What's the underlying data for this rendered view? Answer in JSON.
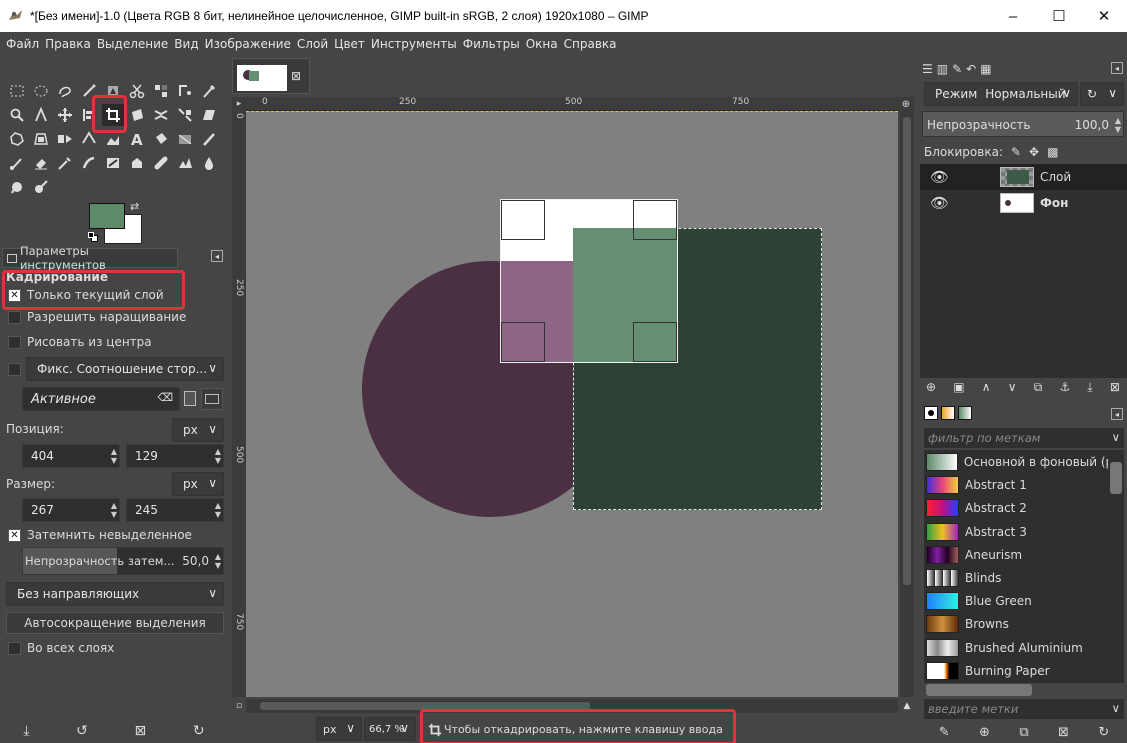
{
  "window": {
    "title": "*[Без имени]-1.0 (Цвета RGB 8 бит, нелинейное целочисленное, GIMP built-in sRGB, 2 слоя) 1920x1080 – GIMP",
    "minimize": "–",
    "maximize": "☐",
    "close": "✕"
  },
  "menu": [
    "Файл",
    "Правка",
    "Выделение",
    "Вид",
    "Изображение",
    "Слой",
    "Цвет",
    "Инструменты",
    "Фильтры",
    "Окна",
    "Справка"
  ],
  "colors": {
    "foreground": "#5e8a6c",
    "background": "#ffffff",
    "highlight": "#e0343a",
    "circle": "#4a3040",
    "dark_square": "#2d4234",
    "green_square": "#658f73",
    "pink_overlap": "#8e6685"
  },
  "tool_options": {
    "tab_label": "Параметры инструментов",
    "tool_name": "Кадрирование",
    "current_layer_only": "Только текущий слой",
    "allow_growing": "Разрешить наращивание",
    "expand_from_center": "Рисовать из центра",
    "fixed_aspect": "Фикс. Соотношение стор...",
    "active_label": "Активное",
    "position_label": "Позиция:",
    "position_unit": "px",
    "position_x": "404",
    "position_y": "129",
    "size_label": "Размер:",
    "size_unit": "px",
    "size_w": "267",
    "size_h": "245",
    "highlight_label": "Затемнить невыделенное",
    "highlight_opacity_label": "Непрозрачность затем...",
    "highlight_opacity_value": "50,0",
    "guides": "Без направляющих",
    "auto_shrink": "Автосокращение выделения",
    "shrink_merged": "Во всех слоях"
  },
  "rulers": {
    "top": [
      "0",
      "250",
      "500",
      "750"
    ],
    "left": [
      "0",
      "250",
      "500",
      "750"
    ]
  },
  "status": {
    "unit": "px",
    "zoom": "66,7 %",
    "message": "Чтобы откадрировать, нажмите клавишу ввода"
  },
  "layers_panel": {
    "mode_label": "Режим",
    "mode_value": "Нормальный",
    "opacity_label": "Непрозрачность",
    "opacity_value": "100,0",
    "lock_label": "Блокировка:",
    "layers": [
      {
        "name": "Слой"
      },
      {
        "name": "Фон"
      }
    ]
  },
  "gradients_panel": {
    "filter_placeholder": "фильтр по меткам",
    "tag_placeholder": "введите метки",
    "items": [
      {
        "name": "Основной в фоновый (р",
        "swatch": "linear-gradient(90deg,#5e8a6c,#ffffff)"
      },
      {
        "name": "Abstract 1",
        "swatch": "linear-gradient(90deg,#3c2dd6,#e8457a,#f0d040)"
      },
      {
        "name": "Abstract 2",
        "swatch": "linear-gradient(90deg,#ff2030,#c01080,#2040ff)"
      },
      {
        "name": "Abstract 3",
        "swatch": "linear-gradient(90deg,#30a040,#f0c020,#a020c0)"
      },
      {
        "name": "Aneurism",
        "swatch": "linear-gradient(90deg,#200020,#8020a0,#200020,#a06060)"
      },
      {
        "name": "Blinds",
        "swatch": "repeating-linear-gradient(90deg,#fff 0px,#222 8px)"
      },
      {
        "name": "Blue Green",
        "swatch": "linear-gradient(90deg,#2080ff,#30f0e0)"
      },
      {
        "name": "Browns",
        "swatch": "linear-gradient(90deg,#6a3a10,#d09040,#5a2a08)"
      },
      {
        "name": "Brushed Aluminium",
        "swatch": "linear-gradient(90deg,#ddd,#888,#eee,#999)"
      },
      {
        "name": "Burning Paper",
        "swatch": "linear-gradient(90deg,#ffffff 55%,#ff8000 62%,#000 72%)"
      }
    ]
  }
}
